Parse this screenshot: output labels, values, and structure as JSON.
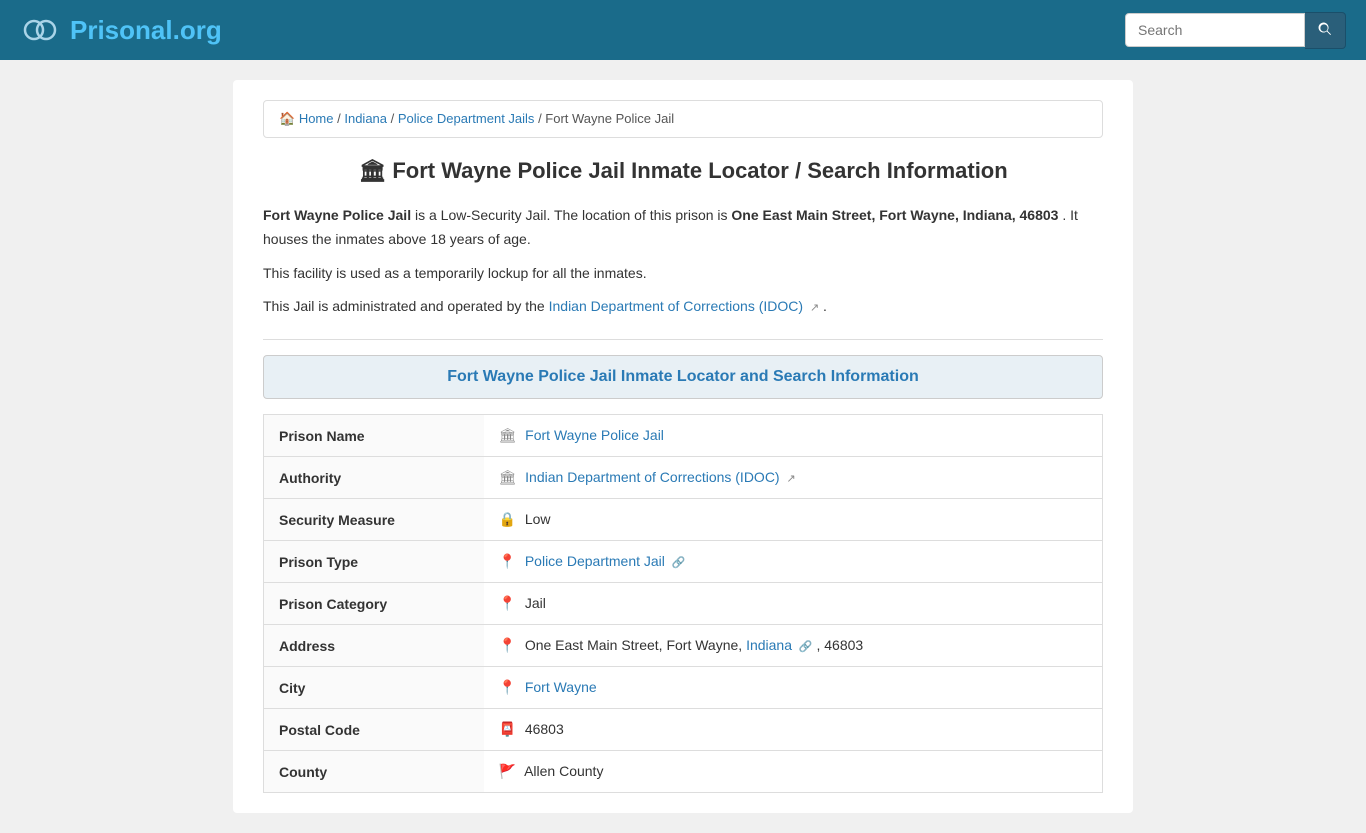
{
  "header": {
    "logo_text": "Prisonal",
    "logo_domain": ".org",
    "search_placeholder": "Search"
  },
  "breadcrumb": {
    "home_label": "Home",
    "home_href": "/",
    "indiana_label": "Indiana",
    "indiana_href": "/indiana",
    "police_jails_label": "Police Department Jails",
    "police_jails_href": "/indiana/police-department-jails",
    "current_label": "Fort Wayne Police Jail"
  },
  "page": {
    "title": "Fort Wayne Police Jail Inmate Locator / Search Information",
    "description1_prefix": " is a Low-Security Jail. The location of this prison is ",
    "description1_address": "One East Main Street, Fort Wayne, Indiana, 46803",
    "description1_suffix": ". It houses the inmates above 18 years of age.",
    "description1_jail_name": "Fort Wayne Police Jail",
    "description2": "This facility is used as a temporarily lockup for all the inmates.",
    "description3_prefix": "This Jail is administrated and operated by the ",
    "description3_link": "Indian Department of Corrections (IDOC)",
    "description3_suffix": ".",
    "section_title": "Fort Wayne Police Jail Inmate Locator and Search Information"
  },
  "table": {
    "rows": [
      {
        "label": "Prison Name",
        "icon": "🏛",
        "value": "Fort Wayne Police Jail",
        "is_link": true,
        "link_href": "#"
      },
      {
        "label": "Authority",
        "icon": "🏛",
        "value": "Indian Department of Corrections (IDOC)",
        "is_link": true,
        "link_href": "#",
        "has_ext": true
      },
      {
        "label": "Security Measure",
        "icon": "🔒",
        "value": "Low",
        "is_link": false
      },
      {
        "label": "Prison Type",
        "icon": "📍",
        "value": "Police Department Jail",
        "is_link": true,
        "link_href": "#",
        "has_ext": true
      },
      {
        "label": "Prison Category",
        "icon": "📍",
        "value": "Jail",
        "is_link": false
      },
      {
        "label": "Address",
        "icon": "📍",
        "value_prefix": "One East Main Street, Fort Wayne, ",
        "value_link": "Indiana",
        "value_suffix": ", 46803",
        "is_address": true
      },
      {
        "label": "City",
        "icon": "📍",
        "value": "Fort Wayne",
        "is_link": true,
        "link_href": "#"
      },
      {
        "label": "Postal Code",
        "icon": "📮",
        "value": "46803",
        "is_link": false
      },
      {
        "label": "County",
        "icon": "🚩",
        "value": "Allen County",
        "is_link": false
      }
    ]
  }
}
